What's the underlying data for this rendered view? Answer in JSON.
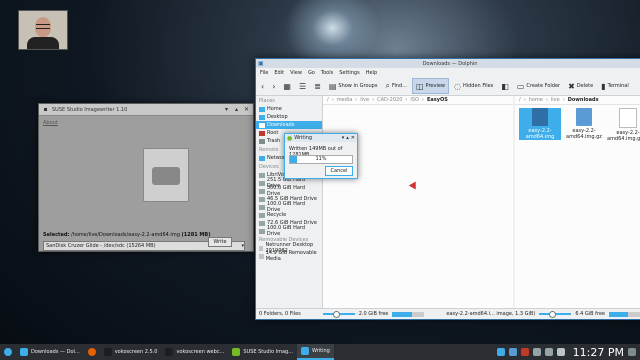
{
  "imagewriter": {
    "title": "SUSE Studio Imagewriter 1.10",
    "about": "About",
    "selected_label": "Selected:",
    "selected_path": "/home/live/Downloads/easy-2.2-amd64.img",
    "selected_size": "(1281 MB)",
    "device": "SanDisk Cruzer Glide - /dev/sdc (15264 MB)",
    "write_button": "Write"
  },
  "dolphin": {
    "title": "Downloads — Dolphin",
    "menu": [
      "File",
      "Edit",
      "View",
      "Go",
      "Tools",
      "Settings",
      "Help"
    ],
    "toolbar": {
      "show_in_groups": "Show in Groups",
      "find": "Find...",
      "preview": "Preview",
      "hidden_files": "Hidden Files",
      "create_folder": "Create Folder",
      "delete": "Delete",
      "terminal": "Terminal"
    },
    "places": {
      "header": "Places",
      "items": [
        "Home",
        "Desktop",
        "Downloads",
        "Root",
        "Trash"
      ],
      "remote_header": "Remote",
      "remote_items": [
        "Network"
      ],
      "devices_header": "Devices",
      "device_items": [
        "LibriVox",
        "251.5 GiB Hard Drive",
        "300.0 GiB Hard Drive",
        "46.5 GiB Hard Drive",
        "100.0 GiB Hard Drive",
        "Recycle",
        "72.6 GiB Hard Drive",
        "100.0 GiB Hard Drive"
      ],
      "removable_header": "Removable Devices",
      "removable_items": [
        "Netrunner Desktop 2019082",
        "14.9 GiB Removable Media"
      ]
    },
    "left_breadcrumb": [
      "/",
      "media",
      "live",
      "CAD-2020",
      "ISO",
      "EasyOS"
    ],
    "right_breadcrumb": [
      "/",
      "home",
      "live",
      "Downloads"
    ],
    "files": [
      {
        "name": "easy-2.2-amd64.img",
        "selected": true
      },
      {
        "name": "easy-2.2-amd64.img.gz",
        "selected": false
      },
      {
        "name": "easy-2.2-amd64.img.gz.md5.txt",
        "selected": false
      }
    ],
    "status_left": "0 Folders, 0 Files",
    "status_left_free": "2.0 GiB free",
    "status_right": "easy-2.2-amd64.i... image, 1.3 GiB)",
    "status_right_free": "6.4 GiB free"
  },
  "writing_dialog": {
    "title": "Writing",
    "message": "Written 149MB out of 1281MB",
    "percent_label": "11%",
    "progress": 0.11,
    "cancel": "Cancel"
  },
  "taskbar": {
    "tasks": [
      {
        "label": "Downloads — Dol...",
        "color": "#3daee9"
      },
      {
        "label": "",
        "color": "#e66000"
      },
      {
        "label": "vokoscreen 2.5.0",
        "color": "#1d1d1d"
      },
      {
        "label": "vokoscreen webc...",
        "color": "#1d1d1d"
      },
      {
        "label": "SUSE Studio Imag...",
        "color": "#73ba25"
      },
      {
        "label": "Writing",
        "color": "#3daee9"
      }
    ],
    "clock": "11:27 PM"
  },
  "colors": {
    "accent": "#3daee9",
    "taskbar": "#2a2e32"
  }
}
